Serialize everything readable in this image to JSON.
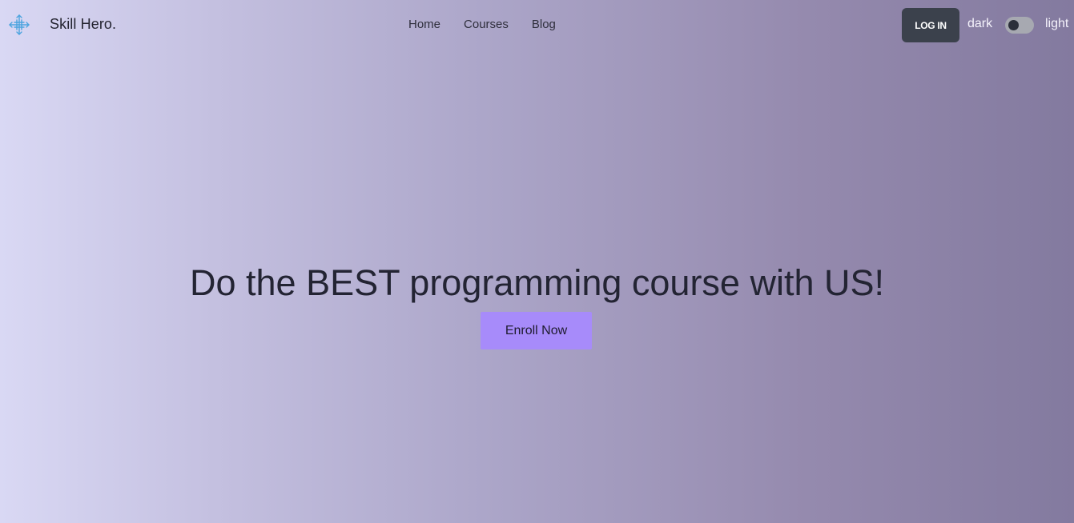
{
  "navbar": {
    "logo_icon": "crosshair-arrows-icon",
    "brand": "Skill Hero.",
    "links": [
      {
        "label": "Home"
      },
      {
        "label": "Courses"
      },
      {
        "label": "Blog"
      }
    ],
    "login_label": "LOG IN",
    "theme_toggle": {
      "dark_label": "dark",
      "light_label": "light",
      "state": "dark"
    }
  },
  "hero": {
    "title": "Do the BEST programming course with US!",
    "cta_label": "Enroll Now"
  },
  "colors": {
    "accent": "#a78bfa",
    "login_button": "#3b414c",
    "text_dark": "#232433",
    "gradient_start": "#d9d8f4",
    "gradient_end": "#837a9f",
    "logo_icon": "#4aa3df"
  }
}
